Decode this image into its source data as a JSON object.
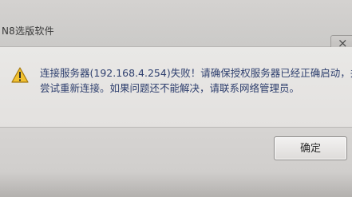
{
  "window": {
    "title": "N8选版软件"
  },
  "dialog": {
    "close_label": "×",
    "icon": "warning-icon",
    "message_line1": "连接服务器(192.168.4.254)失败！请确保授权服务器已经正确启动，并",
    "message_line2": "尝试重新连接。如果问题还不能解决，请联系网络管理员。",
    "ok_label": "确定"
  },
  "colors": {
    "message_text": "#2e3f6e",
    "warning_fill": "#f2c230",
    "warning_outline": "#a67a0f"
  }
}
